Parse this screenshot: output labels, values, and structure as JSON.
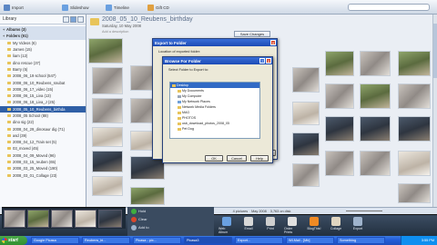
{
  "colors": {
    "accent": "#2f5fa6",
    "xp_title": "#1c4bb5",
    "taskbar": "#245edb",
    "start": "#2f8f2f"
  },
  "toolbar": {
    "import": "Import",
    "slideshow": "Slideshow",
    "timeline": "Timeline",
    "gift_cd": "Gift CD"
  },
  "sidebar": {
    "header": "Library",
    "items": [
      {
        "label": "Albums (3)",
        "type": "group"
      },
      {
        "label": "Folders (91)",
        "type": "group"
      },
      {
        "label": "My Videos (6)",
        "type": "sub"
      },
      {
        "label": "James (15)",
        "type": "sub"
      },
      {
        "label": "liam (12)",
        "type": "sub"
      },
      {
        "label": "dino rescue (37)",
        "type": "sub"
      },
      {
        "label": "Barry (5)",
        "type": "sub"
      },
      {
        "label": "2008_06_19 school (547)",
        "type": "sub"
      },
      {
        "label": "2008_06_10_Reubens_snubat",
        "type": "sub"
      },
      {
        "label": "2008_06_17_video (15)",
        "type": "sub"
      },
      {
        "label": "2008_06_15_Liva (13)",
        "type": "sub"
      },
      {
        "label": "2008_06_18_Liva_J (25)",
        "type": "sub"
      },
      {
        "label": "2008_05_10_Reubens_birthda",
        "type": "sel"
      },
      {
        "label": "2008_05 School (88)",
        "type": "sub"
      },
      {
        "label": "dino sig (22)",
        "type": "sub"
      },
      {
        "label": "2008_04_29_dinosaur dig (71)",
        "type": "sub"
      },
      {
        "label": "asd (39)",
        "type": "sub"
      },
      {
        "label": "2008_04_12_Train set (5)",
        "type": "sub"
      },
      {
        "label": "03_moved (45)",
        "type": "sub"
      },
      {
        "label": "2008_04_09_Moved (96)",
        "type": "sub"
      },
      {
        "label": "2008_03_15_reuben (65)",
        "type": "sub"
      },
      {
        "label": "2008_03_25_Moved (190)",
        "type": "sub"
      },
      {
        "label": "2008_03_01_Collage (23)",
        "type": "sub"
      }
    ]
  },
  "header": {
    "title": "2008_05_10_Reubens_birthday",
    "date": "Saturday, 10 May 2008",
    "description": "Add a description",
    "save_changes": "Save Changes"
  },
  "status": {
    "pictures": "4 pictures",
    "date": "May 2008",
    "size": "3,763 on disk"
  },
  "export_dialog": {
    "title": "Export to Folder",
    "location_label": "Location of exported folder:",
    "ok": "OK",
    "cancel": "Cancel"
  },
  "browse_dialog": {
    "title": "Browse For Folder",
    "prompt": "Select Folder to Export to:",
    "tree": [
      {
        "label": "Desktop",
        "kind": "folder",
        "indent": 0,
        "selected": true
      },
      {
        "label": "My Documents",
        "kind": "folder",
        "indent": 1
      },
      {
        "label": "My Computer",
        "kind": "drive",
        "indent": 1
      },
      {
        "label": "My Network Places",
        "kind": "net",
        "indent": 1
      },
      {
        "label": "Network Media Folders",
        "kind": "folder",
        "indent": 1
      },
      {
        "label": "MAG",
        "kind": "folder",
        "indent": 1
      },
      {
        "label": "PHOTOS",
        "kind": "folder",
        "indent": 1
      },
      {
        "label": "usb_download_photos_2008_05",
        "kind": "folder",
        "indent": 1
      },
      {
        "label": "Pet Dog",
        "kind": "folder",
        "indent": 1
      }
    ],
    "ok": "OK",
    "cancel": "Cancel",
    "help": "Help"
  },
  "tray": {
    "hold": "Hold",
    "clear": "Clear",
    "add_to": "Add to"
  },
  "actions": [
    {
      "label": "Web Album",
      "icon": "web-album-icon",
      "color": "#6aa0e0"
    },
    {
      "label": "Email",
      "icon": "email-icon",
      "color": "#d8d8d8"
    },
    {
      "label": "Print",
      "icon": "print-icon",
      "color": "#cfcfcf"
    },
    {
      "label": "Order Prints",
      "icon": "order-prints-icon",
      "color": "#e0e0e0"
    },
    {
      "label": "BlogThis!",
      "icon": "blog-icon",
      "color": "#f08a24"
    },
    {
      "label": "Collage",
      "icon": "collage-icon",
      "color": "#e0d5c0"
    },
    {
      "label": "Export",
      "icon": "export-icon",
      "color": "#9fb3cc"
    }
  ],
  "taskbar": {
    "start": "start",
    "tasks": [
      "Google Picasa",
      "Reubens_bi...",
      "Picasa - pix...",
      "Picasa3",
      "Export...",
      "WLMail - [Mb]",
      "Something"
    ],
    "clock": "3:55 PM"
  }
}
